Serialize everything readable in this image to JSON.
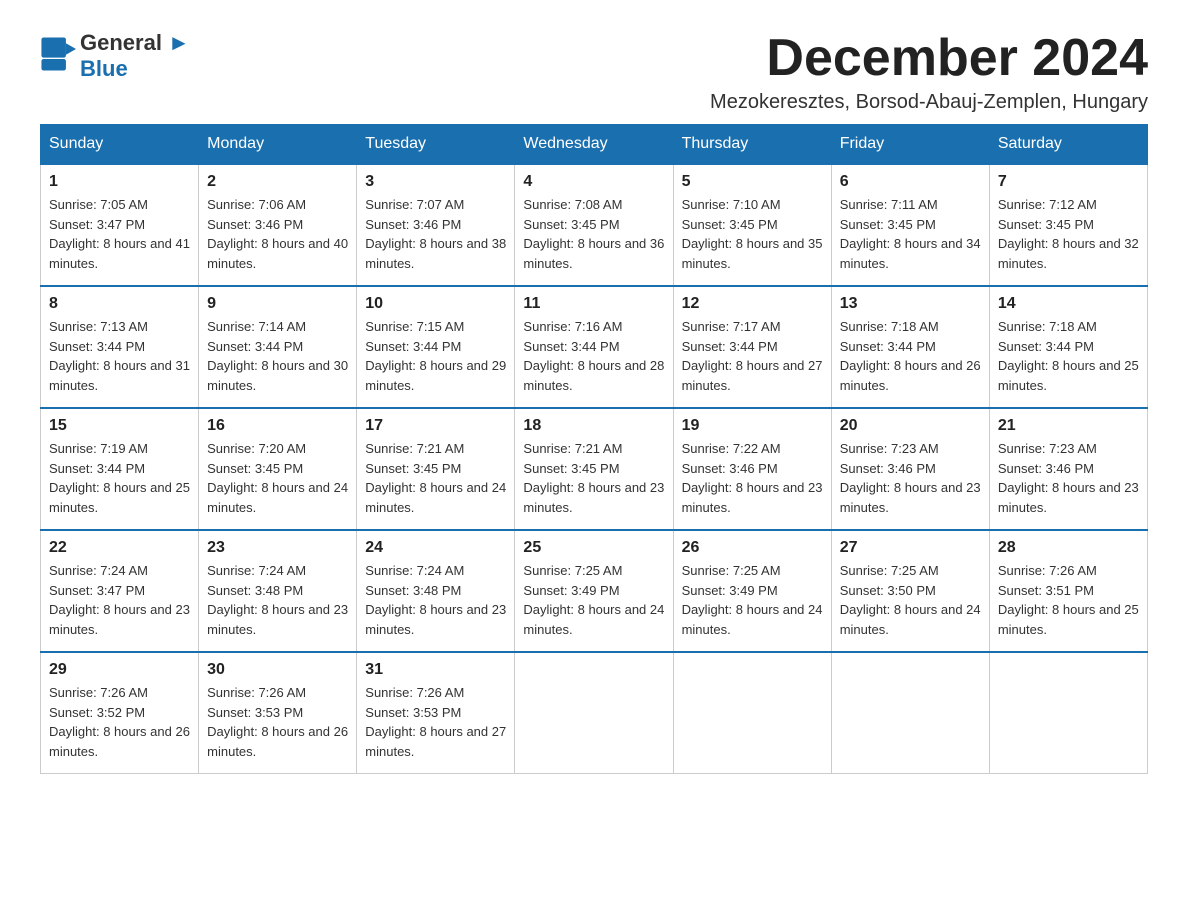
{
  "logo": {
    "text_general": "General",
    "text_blue": "Blue",
    "arrow": "▶"
  },
  "title": "December 2024",
  "subtitle": "Mezokeresztes, Borsod-Abauj-Zemplen, Hungary",
  "weekdays": [
    "Sunday",
    "Monday",
    "Tuesday",
    "Wednesday",
    "Thursday",
    "Friday",
    "Saturday"
  ],
  "weeks": [
    [
      {
        "day": "1",
        "sunrise": "7:05 AM",
        "sunset": "3:47 PM",
        "daylight": "8 hours and 41 minutes."
      },
      {
        "day": "2",
        "sunrise": "7:06 AM",
        "sunset": "3:46 PM",
        "daylight": "8 hours and 40 minutes."
      },
      {
        "day": "3",
        "sunrise": "7:07 AM",
        "sunset": "3:46 PM",
        "daylight": "8 hours and 38 minutes."
      },
      {
        "day": "4",
        "sunrise": "7:08 AM",
        "sunset": "3:45 PM",
        "daylight": "8 hours and 36 minutes."
      },
      {
        "day": "5",
        "sunrise": "7:10 AM",
        "sunset": "3:45 PM",
        "daylight": "8 hours and 35 minutes."
      },
      {
        "day": "6",
        "sunrise": "7:11 AM",
        "sunset": "3:45 PM",
        "daylight": "8 hours and 34 minutes."
      },
      {
        "day": "7",
        "sunrise": "7:12 AM",
        "sunset": "3:45 PM",
        "daylight": "8 hours and 32 minutes."
      }
    ],
    [
      {
        "day": "8",
        "sunrise": "7:13 AM",
        "sunset": "3:44 PM",
        "daylight": "8 hours and 31 minutes."
      },
      {
        "day": "9",
        "sunrise": "7:14 AM",
        "sunset": "3:44 PM",
        "daylight": "8 hours and 30 minutes."
      },
      {
        "day": "10",
        "sunrise": "7:15 AM",
        "sunset": "3:44 PM",
        "daylight": "8 hours and 29 minutes."
      },
      {
        "day": "11",
        "sunrise": "7:16 AM",
        "sunset": "3:44 PM",
        "daylight": "8 hours and 28 minutes."
      },
      {
        "day": "12",
        "sunrise": "7:17 AM",
        "sunset": "3:44 PM",
        "daylight": "8 hours and 27 minutes."
      },
      {
        "day": "13",
        "sunrise": "7:18 AM",
        "sunset": "3:44 PM",
        "daylight": "8 hours and 26 minutes."
      },
      {
        "day": "14",
        "sunrise": "7:18 AM",
        "sunset": "3:44 PM",
        "daylight": "8 hours and 25 minutes."
      }
    ],
    [
      {
        "day": "15",
        "sunrise": "7:19 AM",
        "sunset": "3:44 PM",
        "daylight": "8 hours and 25 minutes."
      },
      {
        "day": "16",
        "sunrise": "7:20 AM",
        "sunset": "3:45 PM",
        "daylight": "8 hours and 24 minutes."
      },
      {
        "day": "17",
        "sunrise": "7:21 AM",
        "sunset": "3:45 PM",
        "daylight": "8 hours and 24 minutes."
      },
      {
        "day": "18",
        "sunrise": "7:21 AM",
        "sunset": "3:45 PM",
        "daylight": "8 hours and 23 minutes."
      },
      {
        "day": "19",
        "sunrise": "7:22 AM",
        "sunset": "3:46 PM",
        "daylight": "8 hours and 23 minutes."
      },
      {
        "day": "20",
        "sunrise": "7:23 AM",
        "sunset": "3:46 PM",
        "daylight": "8 hours and 23 minutes."
      },
      {
        "day": "21",
        "sunrise": "7:23 AM",
        "sunset": "3:46 PM",
        "daylight": "8 hours and 23 minutes."
      }
    ],
    [
      {
        "day": "22",
        "sunrise": "7:24 AM",
        "sunset": "3:47 PM",
        "daylight": "8 hours and 23 minutes."
      },
      {
        "day": "23",
        "sunrise": "7:24 AM",
        "sunset": "3:48 PM",
        "daylight": "8 hours and 23 minutes."
      },
      {
        "day": "24",
        "sunrise": "7:24 AM",
        "sunset": "3:48 PM",
        "daylight": "8 hours and 23 minutes."
      },
      {
        "day": "25",
        "sunrise": "7:25 AM",
        "sunset": "3:49 PM",
        "daylight": "8 hours and 24 minutes."
      },
      {
        "day": "26",
        "sunrise": "7:25 AM",
        "sunset": "3:49 PM",
        "daylight": "8 hours and 24 minutes."
      },
      {
        "day": "27",
        "sunrise": "7:25 AM",
        "sunset": "3:50 PM",
        "daylight": "8 hours and 24 minutes."
      },
      {
        "day": "28",
        "sunrise": "7:26 AM",
        "sunset": "3:51 PM",
        "daylight": "8 hours and 25 minutes."
      }
    ],
    [
      {
        "day": "29",
        "sunrise": "7:26 AM",
        "sunset": "3:52 PM",
        "daylight": "8 hours and 26 minutes."
      },
      {
        "day": "30",
        "sunrise": "7:26 AM",
        "sunset": "3:53 PM",
        "daylight": "8 hours and 26 minutes."
      },
      {
        "day": "31",
        "sunrise": "7:26 AM",
        "sunset": "3:53 PM",
        "daylight": "8 hours and 27 minutes."
      },
      null,
      null,
      null,
      null
    ]
  ],
  "labels": {
    "sunrise": "Sunrise:",
    "sunset": "Sunset:",
    "daylight": "Daylight:"
  }
}
